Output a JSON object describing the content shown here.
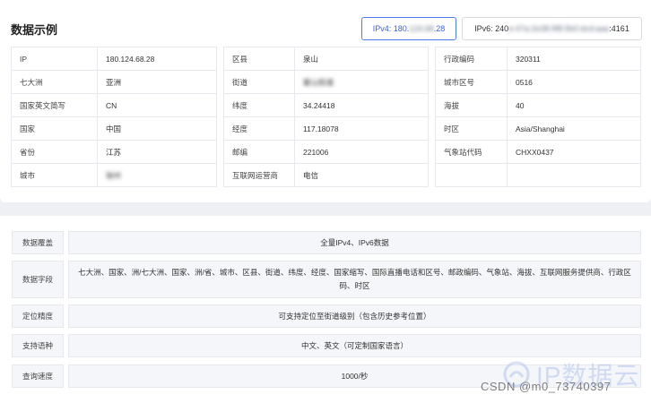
{
  "title": "数据示例",
  "ipv4_button": {
    "prefix": "IPv4: 180.",
    "masked": "124.68",
    "suffix": ".28"
  },
  "ipv6_button": {
    "prefix": "IPv6: 240",
    "masked": "e:47a:2e38:9f8:5b0:dcd:aaa",
    "suffix": ":4161"
  },
  "table1": [
    {
      "key": "IP",
      "value": "180.124.68.28"
    },
    {
      "key": "七大洲",
      "value": "亚洲"
    },
    {
      "key": "国家英文简写",
      "value": "CN"
    },
    {
      "key": "国家",
      "value": "中国"
    },
    {
      "key": "省份",
      "value": "江苏"
    },
    {
      "key": "城市",
      "value": "徐州"
    }
  ],
  "table2": [
    {
      "key": "区县",
      "value": "泉山"
    },
    {
      "key": "街道",
      "value": "翟山街道"
    },
    {
      "key": "纬度",
      "value": "34.24418"
    },
    {
      "key": "经度",
      "value": "117.18078"
    },
    {
      "key": "邮编",
      "value": "221006"
    },
    {
      "key": "互联网运营商",
      "value": "电信"
    }
  ],
  "table3": [
    {
      "key": "行政编码",
      "value": "320311"
    },
    {
      "key": "城市区号",
      "value": "0516"
    },
    {
      "key": "海拔",
      "value": "40"
    },
    {
      "key": "时区",
      "value": "Asia/Shanghai"
    },
    {
      "key": "气象站代码",
      "value": "CHXX0437"
    },
    {
      "key": "",
      "value": ""
    }
  ],
  "specs": [
    {
      "key": "数据覆盖",
      "value": "全量IPv4、IPv6数据"
    },
    {
      "key": "数据字段",
      "value": "七大洲、国家、洲/七大洲、国家、洲/省、城市、区县、街道、纬度、经度、国家缩写、国际直播电话和区号、邮政编码、气象站、海拔、互联网服务提供商、行政区码、时区"
    },
    {
      "key": "定位精度",
      "value": "可支持定位至街道级别（包含历史参考位置）"
    },
    {
      "key": "支持语种",
      "value": "中文、英文（可定制国家语言）"
    },
    {
      "key": "查询速度",
      "value": "1000/秒"
    }
  ],
  "watermark": {
    "brand": "IP数据云",
    "credit": "CSDN @m0_73740397"
  },
  "colors": {
    "accent": "#4d7cf1",
    "border": "#e6e8ee",
    "cell_bg": "#f5f6f9"
  }
}
